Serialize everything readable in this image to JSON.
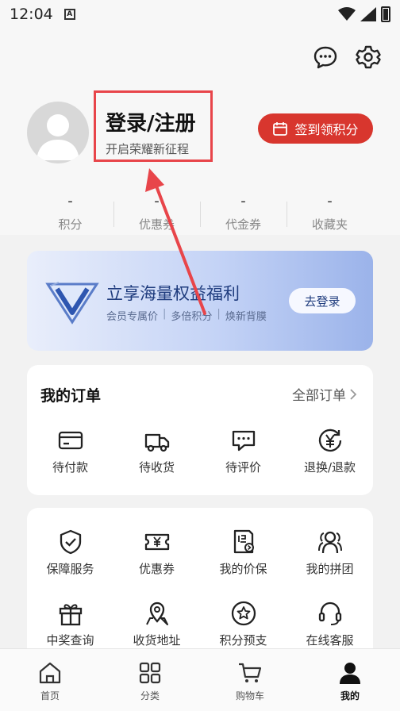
{
  "status_bar": {
    "time": "12:04",
    "notification_icon": "A"
  },
  "header_icons": [
    "message-icon",
    "settings-icon"
  ],
  "profile": {
    "title": "登录/注册",
    "subtitle": "开启荣耀新征程"
  },
  "signin_button": {
    "label": "签到领积分",
    "icon": "calendar-icon",
    "color": "#d8362e"
  },
  "stats": [
    {
      "value": "-",
      "label": "积分"
    },
    {
      "value": "-",
      "label": "优惠券"
    },
    {
      "value": "-",
      "label": "代金券"
    },
    {
      "value": "-",
      "label": "收藏夹"
    }
  ],
  "banner": {
    "title": "立享海量权益福利",
    "subtitles": [
      "会员专属价",
      "多倍积分",
      "焕新背膜"
    ],
    "button": "去登录"
  },
  "orders": {
    "title": "我的订单",
    "all_label": "全部订单",
    "items": [
      {
        "label": "待付款",
        "icon": "card-icon"
      },
      {
        "label": "待收货",
        "icon": "truck-icon"
      },
      {
        "label": "待评价",
        "icon": "comment-icon"
      },
      {
        "label": "退换/退款",
        "icon": "refund-icon"
      }
    ]
  },
  "services": {
    "items": [
      {
        "label": "保障服务",
        "icon": "shield-icon"
      },
      {
        "label": "优惠券",
        "icon": "coupon-icon"
      },
      {
        "label": "我的价保",
        "icon": "price-protect-icon"
      },
      {
        "label": "我的拼团",
        "icon": "group-icon"
      },
      {
        "label": "中奖查询",
        "icon": "gift-icon"
      },
      {
        "label": "收货地址",
        "icon": "location-icon"
      },
      {
        "label": "积分预支",
        "icon": "points-icon"
      },
      {
        "label": "在线客服",
        "icon": "headset-icon"
      }
    ]
  },
  "bottom_nav": [
    {
      "label": "首页",
      "icon": "home-icon"
    },
    {
      "label": "分类",
      "icon": "category-icon"
    },
    {
      "label": "购物车",
      "icon": "cart-icon"
    },
    {
      "label": "我的",
      "icon": "user-icon",
      "active": true
    }
  ],
  "annotation_color": "#e8454a"
}
